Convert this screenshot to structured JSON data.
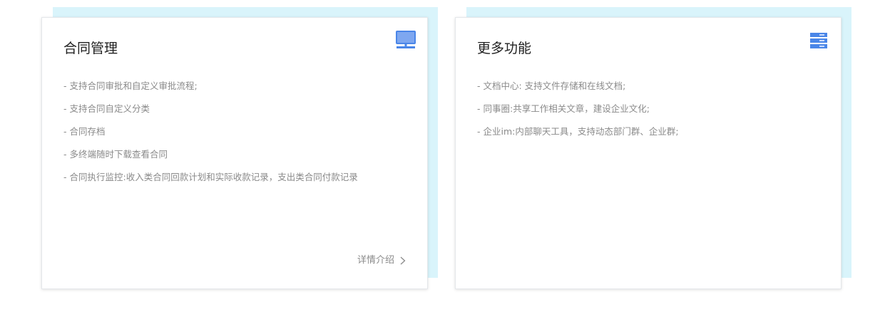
{
  "cards": [
    {
      "title": "合同管理",
      "icon": "monitor-icon",
      "features": [
        "- 支持合同审批和自定义审批流程;",
        "- 支持合同自定义分类",
        "- 合同存档",
        "- 多终端随时下载查看合同",
        "- 合同执行监控:收入类合同回款计划和实际收款记录，支出类合同付款记录"
      ],
      "detail_label": "详情介绍"
    },
    {
      "title": "更多功能",
      "icon": "server-icon",
      "features": [
        "- 文档中心: 支持文件存储和在线文档;",
        "- 同事圈:共享工作相关文章，建设企业文化;",
        "- 企业im:内部聊天工具，支持动态部门群、企业群;"
      ]
    }
  ],
  "colors": {
    "accent_block": "#d9f4fb",
    "icon_blue": "#4a86e8",
    "text_muted": "#8a8a8a"
  }
}
